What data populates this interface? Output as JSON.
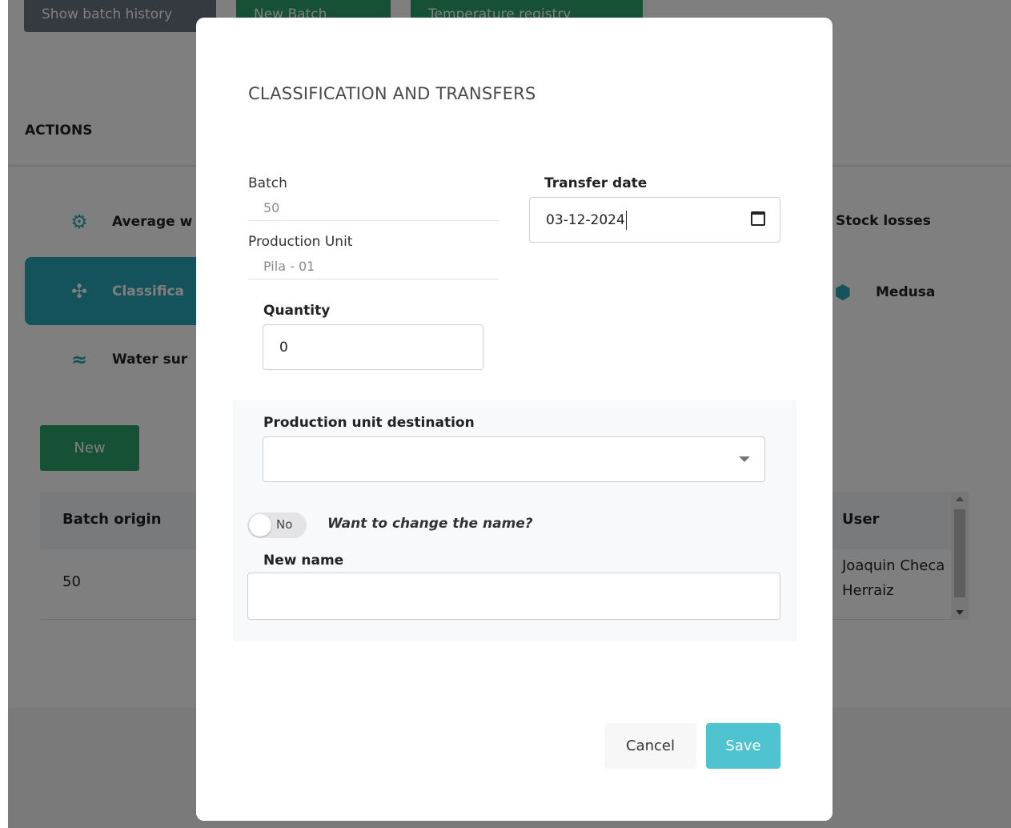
{
  "background": {
    "top_buttons": {
      "batch_history": "Show batch history",
      "new_batch": "New Batch",
      "temperature_registry": "Temperature registry"
    },
    "actions_title": "ACTIONS",
    "actions": {
      "average_weight": "Average w",
      "stock_losses": "Stock losses",
      "classification": "Classifica",
      "medusa": "Medusa",
      "water": "Water sur"
    },
    "new_button": "New",
    "table": {
      "col_batch_origin": "Batch origin",
      "col_user": "User",
      "row": {
        "batch_origin": "50",
        "user": "Joaquin Checa Herraiz"
      }
    }
  },
  "modal": {
    "title": "CLASSIFICATION AND TRANSFERS",
    "batch_label": "Batch",
    "batch_value": "50",
    "production_unit_label": "Production Unit",
    "production_unit_value": "Pila - 01",
    "transfer_date_label": "Transfer date",
    "transfer_date_value": "03-12-2024",
    "quantity_label": "Quantity",
    "quantity_value": "0",
    "destination_label": "Production unit destination",
    "destination_value": "",
    "toggle_state": "No",
    "toggle_question": "Want to change the name?",
    "new_name_label": "New name",
    "new_name_value": "",
    "cancel_label": "Cancel",
    "save_label": "Save"
  },
  "colors": {
    "accent": "#2aa7b8",
    "save": "#4fc3cf",
    "green": "#2fa36b"
  }
}
